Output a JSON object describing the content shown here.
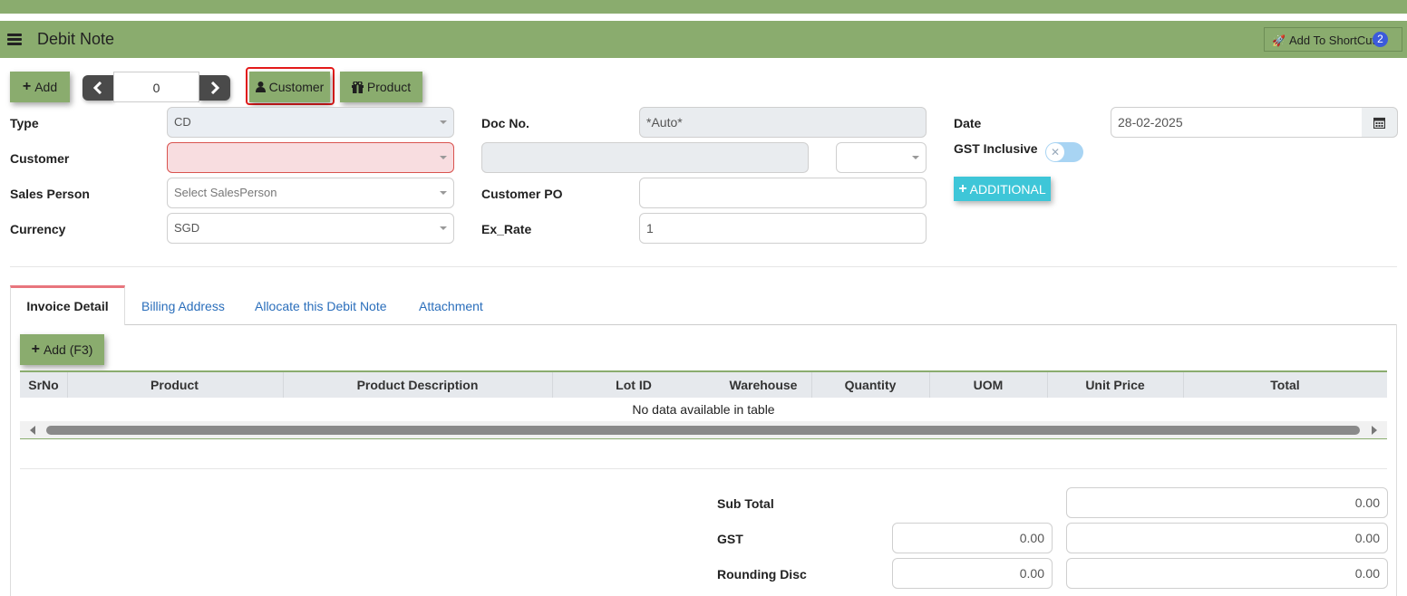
{
  "header": {
    "title": "Debit Note",
    "shortcut_label": "Add To ShortCut",
    "shortcut_count": "2"
  },
  "toolbar": {
    "add_label": "Add",
    "record_index": "0",
    "customer_label": "Customer",
    "product_label": "Product"
  },
  "form": {
    "type": {
      "label": "Type",
      "value": "CD"
    },
    "customer": {
      "label": "Customer",
      "value": ""
    },
    "sales_person": {
      "label": "Sales Person",
      "placeholder": "Select SalesPerson"
    },
    "currency": {
      "label": "Currency",
      "value": "SGD"
    },
    "doc_no": {
      "label": "Doc No.",
      "value": "*Auto*"
    },
    "customer_po": {
      "label": "Customer PO",
      "value": ""
    },
    "ex_rate": {
      "label": "Ex_Rate",
      "value": "1"
    },
    "date": {
      "label": "Date",
      "value": "28-02-2025"
    },
    "gst_inclusive": {
      "label": "GST Inclusive",
      "on": false
    },
    "additional_label": "ADDITIONAL"
  },
  "tabs": [
    {
      "label": "Invoice Detail",
      "active": true
    },
    {
      "label": "Billing Address",
      "active": false
    },
    {
      "label": "Allocate this Debit Note",
      "active": false
    },
    {
      "label": "Attachment",
      "active": false
    }
  ],
  "detail": {
    "add_label": "Add (F3)",
    "columns": [
      "SrNo",
      "Product",
      "Product Description",
      "Lot ID",
      "Warehouse",
      "Quantity",
      "UOM",
      "Unit Price",
      "Total"
    ],
    "empty_text": "No data available in table"
  },
  "totals": {
    "sub_total": {
      "label": "Sub Total",
      "value": "0.00"
    },
    "gst": {
      "label": "GST",
      "rate_value": "0.00",
      "value": "0.00"
    },
    "rounding": {
      "label": "Rounding Disc",
      "rate_value": "0.00",
      "value": "0.00"
    }
  },
  "colors": {
    "brand_green": "#8aac6e",
    "accent_cyan": "#3ec6d8",
    "error_red": "#e41b1b"
  }
}
